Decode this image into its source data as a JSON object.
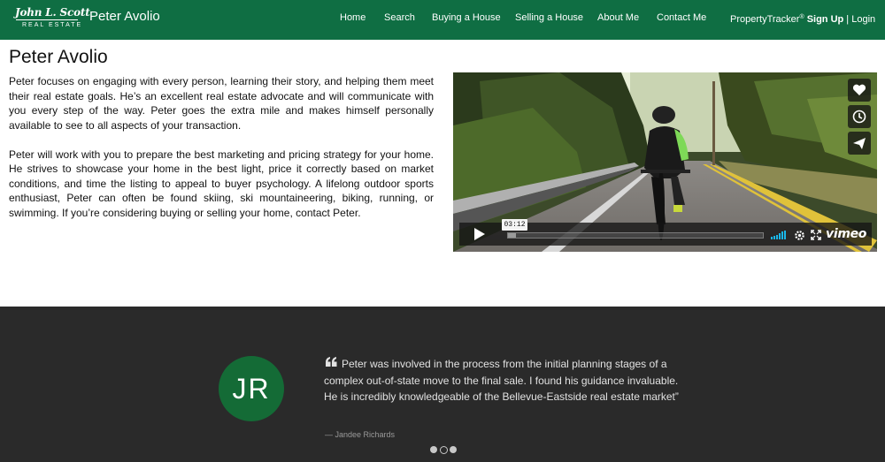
{
  "nav": {
    "logo_script": "John L. Scott",
    "logo_sub": "REAL ESTATE",
    "brand_name": "Peter Avolio",
    "links": [
      "Home",
      "Search",
      "Buying a House",
      "Selling a House",
      "About Me",
      "Contact Me"
    ],
    "tracker": "PropertyTracker",
    "tracker_mark": "®",
    "signup": "Sign Up",
    "separator": " | ",
    "login": "Login"
  },
  "main": {
    "title": "Peter Avolio",
    "paragraphs": [
      "Peter focuses on engaging with every person, learning their story, and helping them meet their real estate goals. He’s an excellent real estate advocate and will communicate with you every step of the way. Peter goes the extra mile and makes himself personally available to see to all aspects of your transaction.",
      "Peter will work with you to prepare the best marketing and pricing strategy for your home. He strives to showcase your home in the best light, price it correctly based on market conditions, and time the listing to appeal to buyer psychology. A lifelong outdoor sports enthusiast, Peter can often be found skiing, ski mountaineering, biking, running, or swimming. If you’re considering buying or selling your home, contact Peter."
    ]
  },
  "video": {
    "time": "03:12",
    "brand": "vimeo",
    "progress": 0.03,
    "icons": [
      "heart-icon",
      "clock-icon",
      "send-icon",
      "play-icon",
      "volume-icon",
      "settings-icon",
      "fullscreen-icon"
    ]
  },
  "testimonial": {
    "initials": "JR",
    "quote": "Peter was involved in the process from the initial planning stages of a complex out-of-state move to the final sale. I found his guidance invaluable. He is incredibly knowledgeable of the Bellevue-Eastside real estate market”",
    "author": "— Jandee Richards",
    "slides": 3,
    "active_slide": 2
  },
  "colors": {
    "nav_bg": "#0f6e43",
    "avatar_bg": "#146b36",
    "testimonial_bg": "#2a2a2a",
    "volume_accent": "#1ab7ea"
  }
}
